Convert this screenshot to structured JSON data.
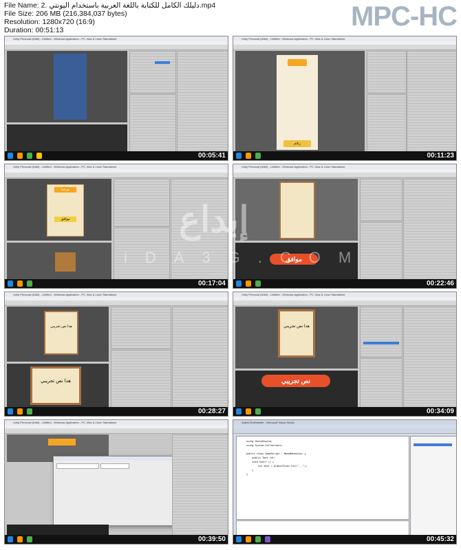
{
  "header": {
    "filename": "File Name: 2. دليلك الكامل للكتابة باللغة العربية باستخدام اليونتي.mp4",
    "filesize": "File Size: 206 MB (216,384,037 bytes)",
    "resolution": "Resolution: 1280x720 (16:9)",
    "duration": "Duration: 00:51:13",
    "logo": "MPC-HC"
  },
  "thumbs": [
    {
      "timestamp": "00:05:41",
      "app_title": "Unity Personal (64bit) - Untitled - Windows Application - PC, Mac & Linux Standalone"
    },
    {
      "timestamp": "00:11:23",
      "app_title": "Unity Personal (64bit) - Untitled - Windows Application - PC, Mac & Linux Standalone",
      "game_text": "رقم"
    },
    {
      "timestamp": "00:17:04",
      "app_title": "Unity Personal (64bit) - Untitled - Windows Application - PC, Mac & Linux Standalone",
      "card_title": "مرحبا",
      "card_button": "موافق"
    },
    {
      "timestamp": "00:22:46",
      "app_title": "Unity Personal (64bit) - Untitled - Windows Application - PC, Mac & Linux Standalone",
      "game_text": "موافق"
    },
    {
      "timestamp": "00:28:27",
      "app_title": "Unity Personal (64bit) - Untitled - Windows Application - PC, Mac & Linux Standalone",
      "card_text": "هذا نص تجريبي"
    },
    {
      "timestamp": "00:34:09",
      "app_title": "Unity Personal (64bit) - Untitled - Windows Application - PC, Mac & Linux Standalone",
      "card_text": "هذا نص تجريبي",
      "game_text": "نص تجريبي"
    },
    {
      "timestamp": "00:39:50",
      "app_title": "Unity Personal (64bit) - Untitled - Windows Application - PC, Mac & Linux Standalone"
    },
    {
      "timestamp": "00:45:32",
      "app_title": "ArabicTextHandler - Microsoft Visual Studio",
      "code": "using UnityEngine;\nusing System.Collections;\n\npublic class SomeScript : MonoBehaviour {\n    public Text txt;\n    void Start () {\n        txt.text = ArabicFixer.Fix(\"...\");\n    }\n}"
    }
  ],
  "watermark": {
    "arabic": "إبداع",
    "latin": "iDA3G.COM"
  }
}
